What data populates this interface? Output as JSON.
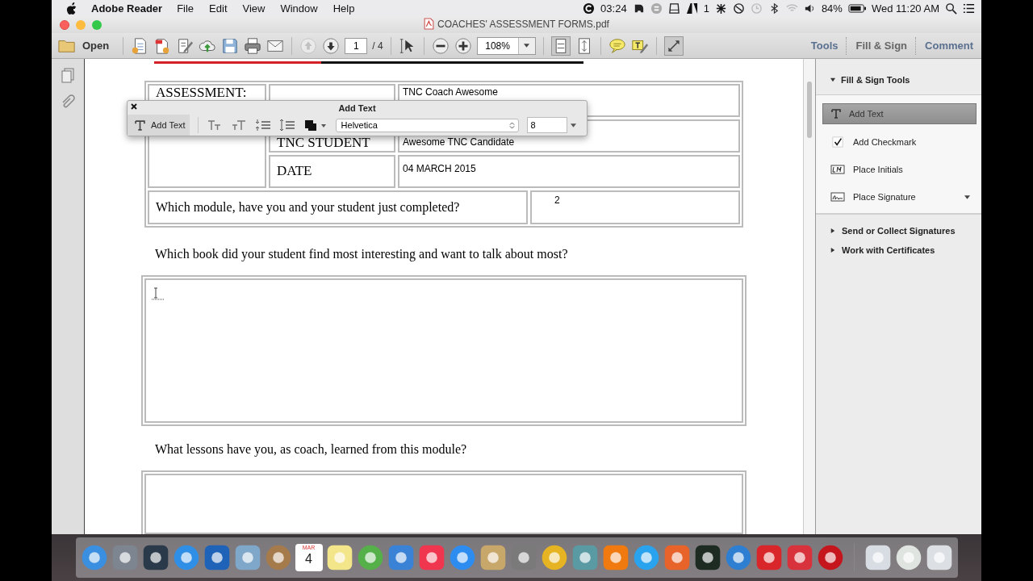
{
  "menu_bar": {
    "app": "Adobe Reader",
    "menus": [
      "File",
      "Edit",
      "View",
      "Window",
      "Help"
    ],
    "timer": "03:24",
    "badge_count": "1",
    "battery": "84%",
    "clock": "Wed 11:20 AM"
  },
  "window": {
    "title": "COACHES' ASSESSMENT FORMS.pdf"
  },
  "toolbar": {
    "open": "Open",
    "page": "1",
    "page_total": "/ 4",
    "zoom": "108%",
    "panes": [
      {
        "label": "Tools",
        "selected": false
      },
      {
        "label": "Fill & Sign",
        "selected": true
      },
      {
        "label": "Comment",
        "selected": false
      }
    ]
  },
  "add_text_panel": {
    "title": "Add Text",
    "tool": "Add Text",
    "font": "Helvetica",
    "size": "8"
  },
  "form": {
    "assessment_label": "ASSESSMENT:",
    "fields": [
      {
        "value": "TNC Coach Awesome"
      },
      {
        "label": "TNC STUDENT",
        "value": "Awesome TNC Candidate"
      },
      {
        "label": "DATE",
        "value": "04 MARCH 2015"
      }
    ],
    "module_question": "Which module, have you and your student just completed?",
    "module_answer": "2",
    "questions": [
      "Which book did your student find most interesting and want to talk about most?",
      "What lessons have you, as coach, learned from this module?"
    ]
  },
  "side_panel": {
    "section": {
      "label": "Fill & Sign Tools",
      "expanded": true
    },
    "tools": [
      {
        "kind": "text",
        "label": "Add Text",
        "selected": true
      },
      {
        "kind": "checkmark",
        "label": "Add Checkmark",
        "selected": false
      },
      {
        "kind": "initials",
        "label": "Place Initials",
        "selected": false
      },
      {
        "kind": "signature",
        "label": "Place Signature",
        "selected": false
      }
    ],
    "sections": [
      {
        "label": "Send or Collect Signatures",
        "expanded": false
      },
      {
        "label": "Work with Certificates",
        "expanded": false
      }
    ]
  },
  "dock": {
    "calendar_month": "MAR",
    "calendar_day": "4"
  }
}
